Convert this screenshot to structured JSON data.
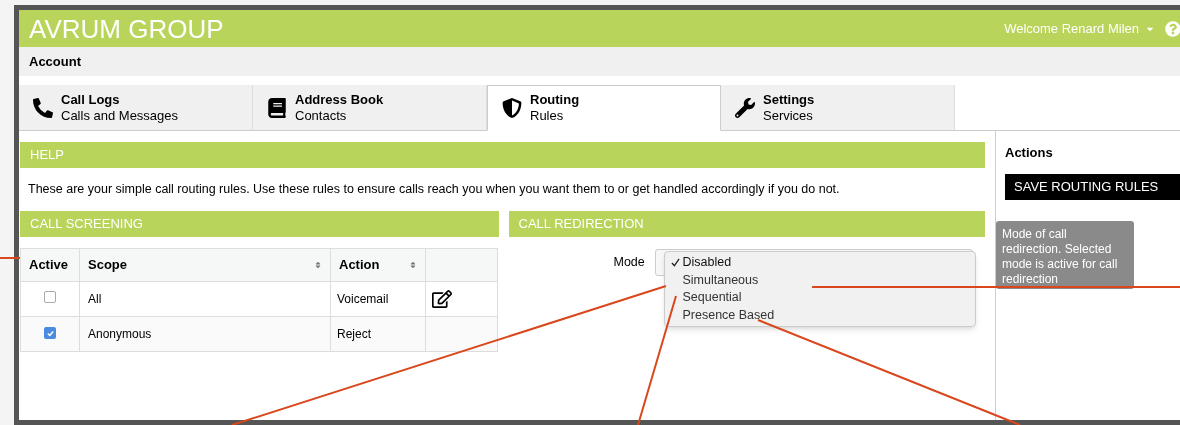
{
  "header": {
    "title": "AVRUM GROUP",
    "user": "Welcome Renard Milen"
  },
  "account_bar": {
    "label": "Account"
  },
  "tabs": [
    {
      "kind": "phone",
      "title": "Call Logs",
      "subtitle": "Calls and Messages",
      "selected": false
    },
    {
      "kind": "book",
      "title": "Address Book",
      "subtitle": "Contacts",
      "selected": false
    },
    {
      "kind": "shield",
      "title": "Routing",
      "subtitle": "Rules",
      "selected": true
    },
    {
      "kind": "wrench",
      "title": "Settings",
      "subtitle": "Services",
      "selected": false
    }
  ],
  "help": {
    "heading": "HELP",
    "text": "These are your simple call routing rules. Use these rules to ensure calls reach you when you want them to or get handled accordingly if you do not."
  },
  "call_screening": {
    "heading": "CALL SCREENING",
    "columns": [
      {
        "label": "Active",
        "sortable": false
      },
      {
        "label": "Scope",
        "sortable": true
      },
      {
        "label": "Action",
        "sortable": true
      }
    ],
    "rows": [
      {
        "active": false,
        "scope": "All",
        "action": "Voicemail",
        "editable": true
      },
      {
        "active": true,
        "scope": "Anonymous",
        "action": "Reject",
        "editable": false
      }
    ]
  },
  "call_redirection": {
    "heading": "CALL REDIRECTION",
    "mode_label": "Mode",
    "options": [
      {
        "label": "Disabled",
        "selected": true
      },
      {
        "label": "Simultaneous",
        "selected": false
      },
      {
        "label": "Sequential",
        "selected": false
      },
      {
        "label": "Presence Based",
        "selected": false
      }
    ],
    "tooltip": "Mode of call redirection. Selected mode is active for call redirection"
  },
  "actions": {
    "heading": "Actions",
    "button": "SAVE ROUTING RULES"
  }
}
